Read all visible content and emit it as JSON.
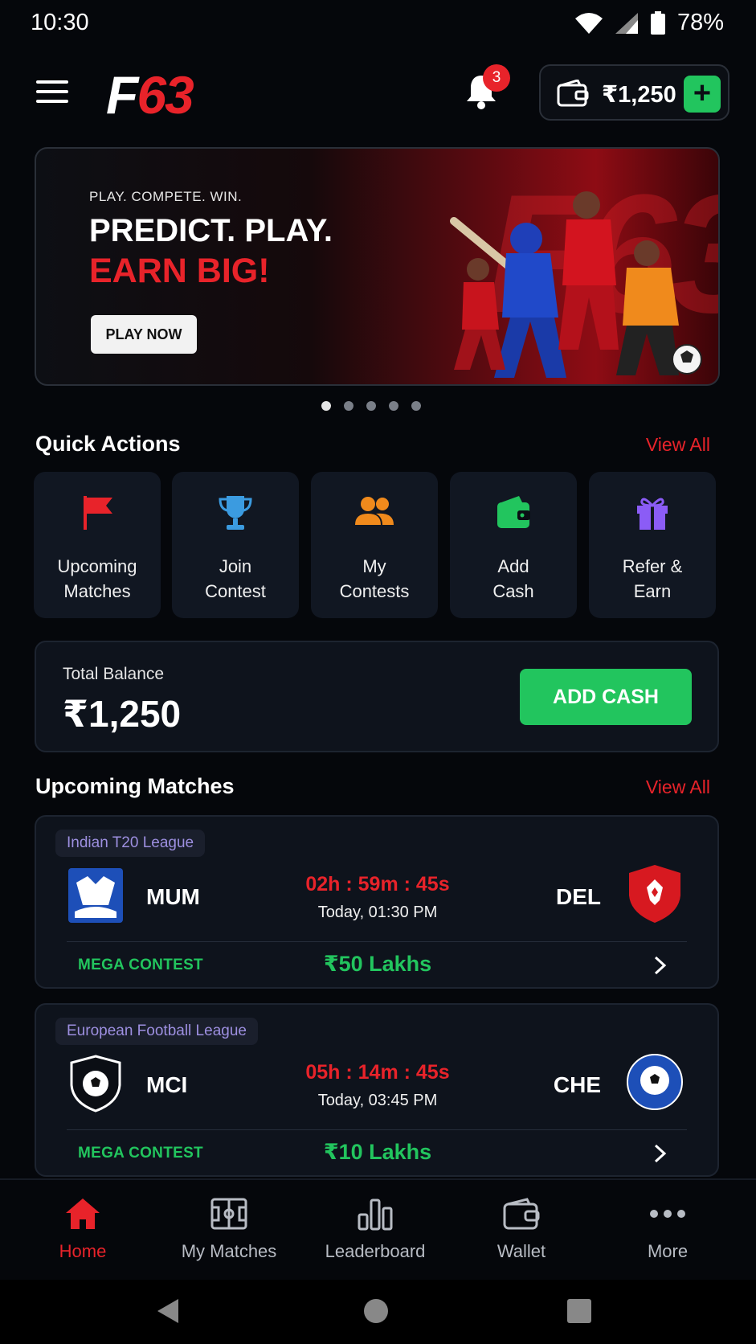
{
  "status_bar": {
    "time": "10:30",
    "battery": "78%"
  },
  "header": {
    "logo_first": "F",
    "logo_second": "63",
    "notification_count": "3",
    "wallet_amount": "₹1,250",
    "add_symbol": "+"
  },
  "banner": {
    "tagline": "PLAY. COMPETE. WIN.",
    "line1": "PREDICT. PLAY.",
    "line2": "EARN BIG!",
    "cta": "PLAY NOW",
    "slides": 5,
    "active_slide": 1
  },
  "quick_actions": {
    "title": "Quick Actions",
    "view_all": "View All",
    "items": [
      {
        "label": "Upcoming\nMatches",
        "icon": "flag-icon"
      },
      {
        "label": "Join\nContest",
        "icon": "trophy-icon"
      },
      {
        "label": "My\nContests",
        "icon": "users-icon"
      },
      {
        "label": "Add\nCash",
        "icon": "wallet-icon"
      },
      {
        "label": "Refer &\nEarn",
        "icon": "gift-icon"
      }
    ]
  },
  "balance": {
    "label": "Total Balance",
    "value": "₹1,250",
    "cta": "ADD CASH"
  },
  "upcoming": {
    "title": "Upcoming Matches",
    "view_all": "View All",
    "matches": [
      {
        "league": "Indian T20 League",
        "team1": "MUM",
        "team2": "DEL",
        "timer": "02h : 59m : 45s",
        "when": "Today, 01:30 PM",
        "contest": "MEGA CONTEST",
        "prize": "₹50 Lakhs"
      },
      {
        "league": "European Football League",
        "team1": "MCI",
        "team2": "CHE",
        "timer": "05h : 14m : 45s",
        "when": "Today, 03:45 PM",
        "contest": "MEGA CONTEST",
        "prize": "₹10 Lakhs"
      }
    ]
  },
  "bottom_nav": {
    "items": [
      {
        "label": "Home",
        "icon": "home-icon",
        "active": true
      },
      {
        "label": "My Matches",
        "icon": "pitch-icon"
      },
      {
        "label": "Leaderboard",
        "icon": "bar-chart-icon"
      },
      {
        "label": "Wallet",
        "icon": "wallet-icon"
      },
      {
        "label": "More",
        "icon": "more-icon"
      }
    ]
  },
  "colors": {
    "accent_red": "#e8232a",
    "accent_green": "#22c55e",
    "background": "#05070b",
    "card": "#0e131c"
  }
}
